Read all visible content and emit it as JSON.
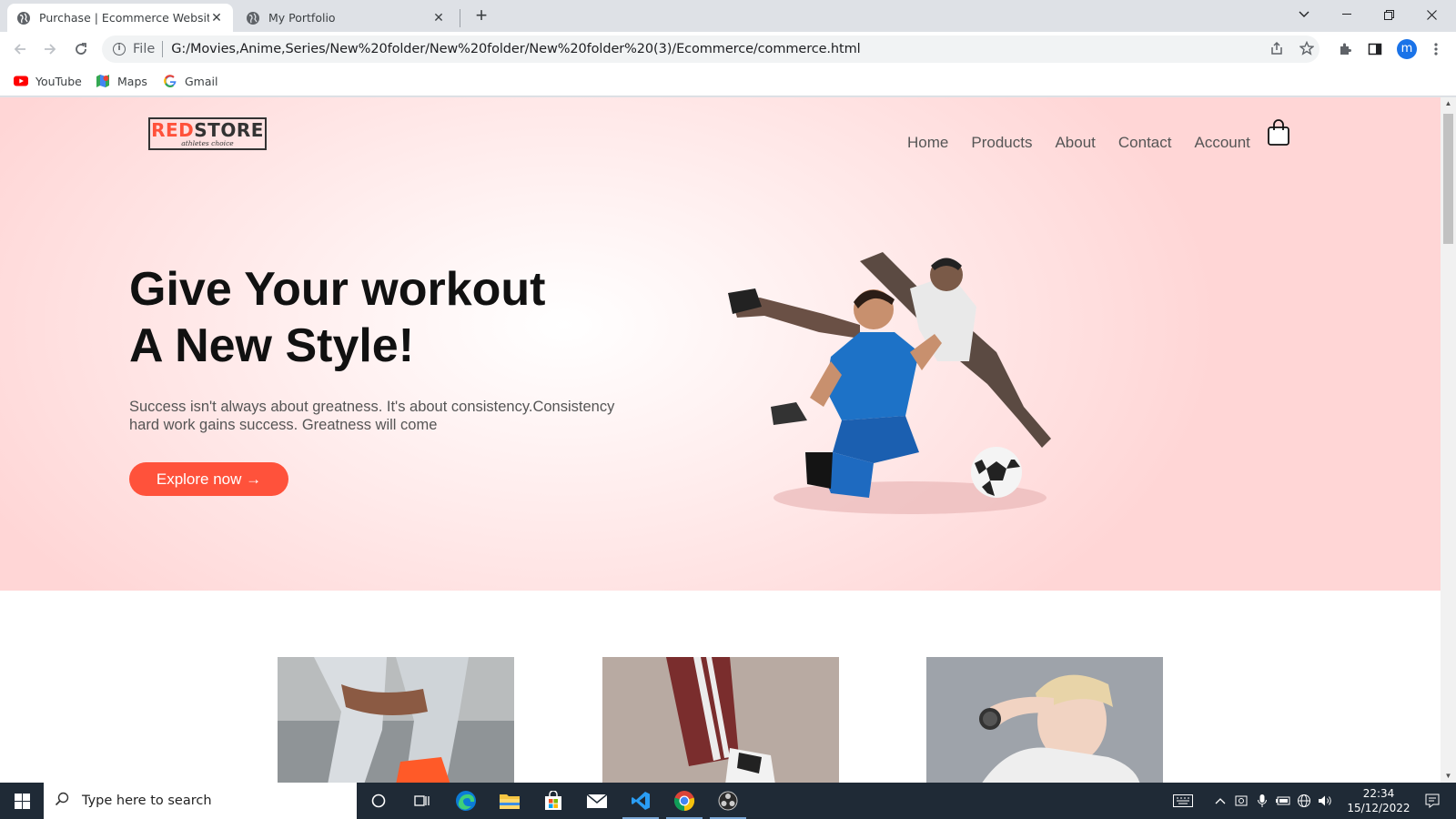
{
  "browser": {
    "tabs": [
      {
        "title": "Purchase | Ecommerce Website",
        "active": true
      },
      {
        "title": "My Portfolio",
        "active": false
      }
    ],
    "new_tab_label": "+",
    "omnibox": {
      "scheme_label": "File",
      "url": "G:/Movies,Anime,Series/New%20folder/New%20folder/New%20folder%20(3)/Ecommerce/commerce.html"
    },
    "profile_initial": "m",
    "bookmarks": [
      {
        "label": "YouTube",
        "icon": "youtube-icon"
      },
      {
        "label": "Maps",
        "icon": "maps-icon"
      },
      {
        "label": "Gmail",
        "icon": "google-icon"
      }
    ]
  },
  "page": {
    "logo": {
      "red_part": "RED",
      "dark_part": "STORE",
      "tagline": "athletes choice"
    },
    "nav": [
      "Home",
      "Products",
      "About",
      "Contact",
      "Account"
    ],
    "hero": {
      "headline_line1": "Give Your workout",
      "headline_line2": "A New Style!",
      "subtext": "Success isn't always about greatness. It's about consistency.Consistency hard work gains success. Greatness will come",
      "cta": "Explore now →"
    },
    "categories": [
      "jeans-sneakers",
      "track-pants-shoes",
      "woman-smartwatch"
    ]
  },
  "taskbar": {
    "search_placeholder": "Type here to search",
    "time": "22:34",
    "date": "15/12/2022"
  },
  "colors": {
    "accent": "#ff523b",
    "hero_bg": "#ffd6d6",
    "taskbar": "#1f2a36",
    "profile": "#1a73e8"
  }
}
